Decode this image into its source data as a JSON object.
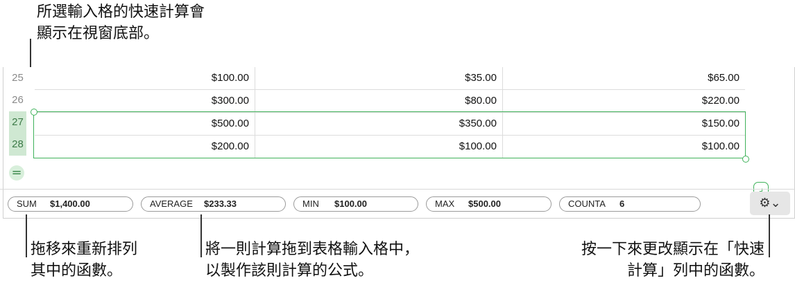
{
  "callouts": {
    "top_line1": "所選輸入格的快速計算會",
    "top_line2": "顯示在視窗底部。",
    "bottom_left_line1": "拖移來重新排列",
    "bottom_left_line2": "其中的函數。",
    "bottom_mid_line1": "將一則計算拖到表格輸入格中，",
    "bottom_mid_line2": "以製作該則計算的公式。",
    "bottom_right_line1": "按一下來更改顯示在「快速",
    "bottom_right_line2": "計算」列中的函數。"
  },
  "table": {
    "rows": [
      {
        "num": "25",
        "cells": [
          "$100.00",
          "$35.00",
          "$65.00"
        ]
      },
      {
        "num": "26",
        "cells": [
          "$300.00",
          "$80.00",
          "$220.00"
        ]
      },
      {
        "num": "27",
        "cells": [
          "$500.00",
          "$350.00",
          "$150.00"
        ]
      },
      {
        "num": "28",
        "cells": [
          "$200.00",
          "$100.00",
          "$100.00"
        ]
      }
    ]
  },
  "quick_calc": [
    {
      "label": "SUM",
      "value": "$1,400.00"
    },
    {
      "label": "AVERAGE",
      "value": "$233.33"
    },
    {
      "label": "MIN",
      "value": "$100.00"
    },
    {
      "label": "MAX",
      "value": "$500.00"
    },
    {
      "label": "COUNTA",
      "value": "6"
    }
  ],
  "icons": {
    "equals_button": "=",
    "corner_button": "⌟",
    "gear_button": "⚙⌄"
  },
  "colors": {
    "selection": "#3fb25a",
    "row_header_selected": "#cfe8d2"
  }
}
